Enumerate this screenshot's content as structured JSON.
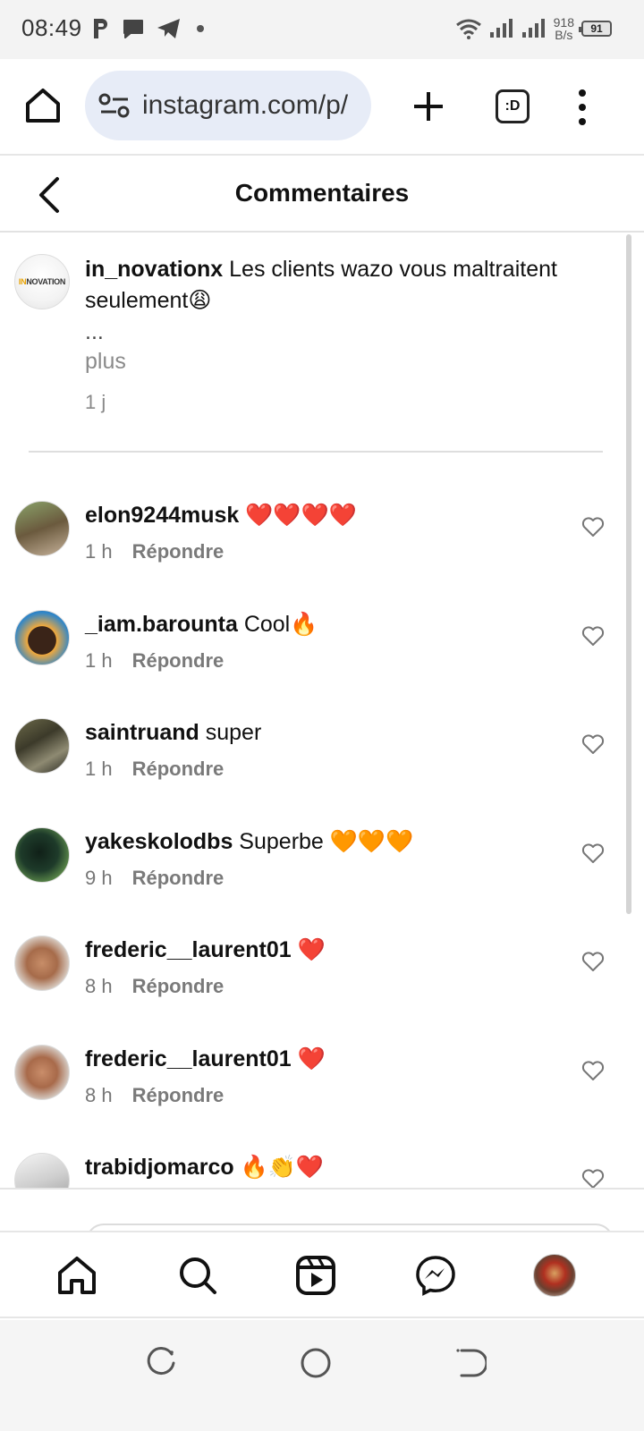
{
  "status_bar": {
    "time": "08:49",
    "net_speed_value": "918",
    "net_speed_unit": "B/s",
    "battery": "91"
  },
  "browser": {
    "url": "instagram.com/p/",
    "tabs_label": ":D"
  },
  "header": {
    "title": "Commentaires"
  },
  "caption": {
    "username": "in_novationx",
    "text": " Les clients wazo vous maltraitent seulement😩",
    "ellipsis": "...",
    "more": "plus",
    "time": "1 j",
    "logo_text_in": "IN",
    "logo_text_rest": "NOVATION"
  },
  "comments": [
    {
      "username": "elon9244musk",
      "text": " ❤️❤️❤️❤️",
      "time": "1 h",
      "reply": "Répondre"
    },
    {
      "username": "_iam.barounta",
      "text": " Cool🔥",
      "time": "1 h",
      "reply": "Répondre"
    },
    {
      "username": "saintruand",
      "text": " super",
      "time": "1 h",
      "reply": "Répondre"
    },
    {
      "username": "yakeskolodbs",
      "text": " Superbe 🧡🧡🧡",
      "time": "9 h",
      "reply": "Répondre"
    },
    {
      "username": "frederic__laurent01",
      "text": " ❤️",
      "time": "8 h",
      "reply": "Répondre"
    },
    {
      "username": "frederic__laurent01",
      "text": " ❤️",
      "time": "8 h",
      "reply": "Répondre"
    },
    {
      "username": "trabidjomarco",
      "text": " 🔥👏❤️",
      "time": "",
      "reply": ""
    }
  ],
  "icons": {
    "home": "home-icon",
    "search": "search-icon",
    "reels": "reels-icon",
    "messenger": "messenger-icon",
    "heart": "heart-outline-icon"
  },
  "colors": {
    "url_pill": "#e7ecf7",
    "muted_text": "#8a8a8a",
    "divider": "#dedede"
  }
}
